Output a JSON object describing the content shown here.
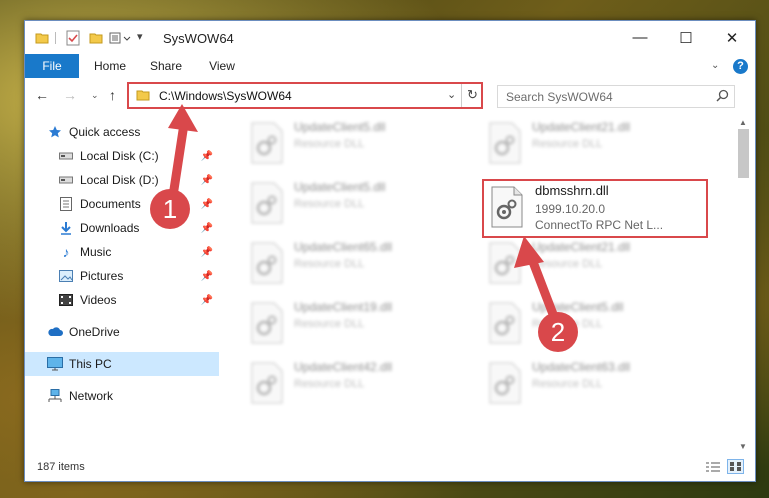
{
  "window": {
    "title": "SysWOW64",
    "minimize": "—",
    "maximize": "☐",
    "close": "✕"
  },
  "ribbon": {
    "tabs": [
      "File",
      "Home",
      "Share",
      "View"
    ],
    "help": "?"
  },
  "nav": {
    "address": "C:\\Windows\\SysWOW64",
    "search_placeholder": "Search SysWOW64"
  },
  "sidebar": {
    "items": [
      {
        "label": "Quick access",
        "icon": "star-icon",
        "pinned": false
      },
      {
        "label": "Local Disk (C:)",
        "icon": "drive-icon",
        "pinned": true
      },
      {
        "label": "Local Disk (D:)",
        "icon": "drive-icon",
        "pinned": true
      },
      {
        "label": "Documents",
        "icon": "documents-icon",
        "pinned": true
      },
      {
        "label": "Downloads",
        "icon": "download-icon",
        "pinned": true
      },
      {
        "label": "Music",
        "icon": "music-icon",
        "pinned": true
      },
      {
        "label": "Pictures",
        "icon": "pictures-icon",
        "pinned": true
      },
      {
        "label": "Videos",
        "icon": "videos-icon",
        "pinned": true
      },
      {
        "label": "OneDrive",
        "icon": "cloud-icon",
        "pinned": false
      },
      {
        "label": "This PC",
        "icon": "computer-icon",
        "pinned": false,
        "selected": true
      },
      {
        "label": "Network",
        "icon": "network-icon",
        "pinned": false
      }
    ]
  },
  "files": {
    "left_column": [
      {
        "name": "UpdateClient5.dll",
        "type": "Resource DLL"
      },
      {
        "name": "UpdateClient5.dll",
        "type": "Resource DLL"
      },
      {
        "name": "UpdateClient65.dll",
        "type": "Resource DLL"
      },
      {
        "name": "UpdateClient19.dll",
        "type": "Resource DLL"
      },
      {
        "name": "UpdateClient42.dll",
        "type": "Resource DLL"
      }
    ],
    "right_column": [
      {
        "name": "UpdateClient21.dll",
        "type": "Resource DLL"
      },
      {
        "name": "UpdateClient21.dll",
        "type": "Resource DLL"
      },
      {
        "name": "UpdateClient5.dll",
        "type": "Resource DLL"
      },
      {
        "name": "UpdateClient63.dll",
        "type": "Resource DLL"
      }
    ],
    "highlighted": {
      "name": "dbmsshrn.dll",
      "version": "1999.10.20.0",
      "description": "ConnectTo RPC Net L..."
    }
  },
  "status": {
    "item_count": "187 items"
  },
  "annotations": {
    "step1": "1",
    "step2": "2"
  },
  "colors": {
    "accent": "#1979ca",
    "highlight": "#d9484b",
    "selected": "#cce8ff"
  }
}
